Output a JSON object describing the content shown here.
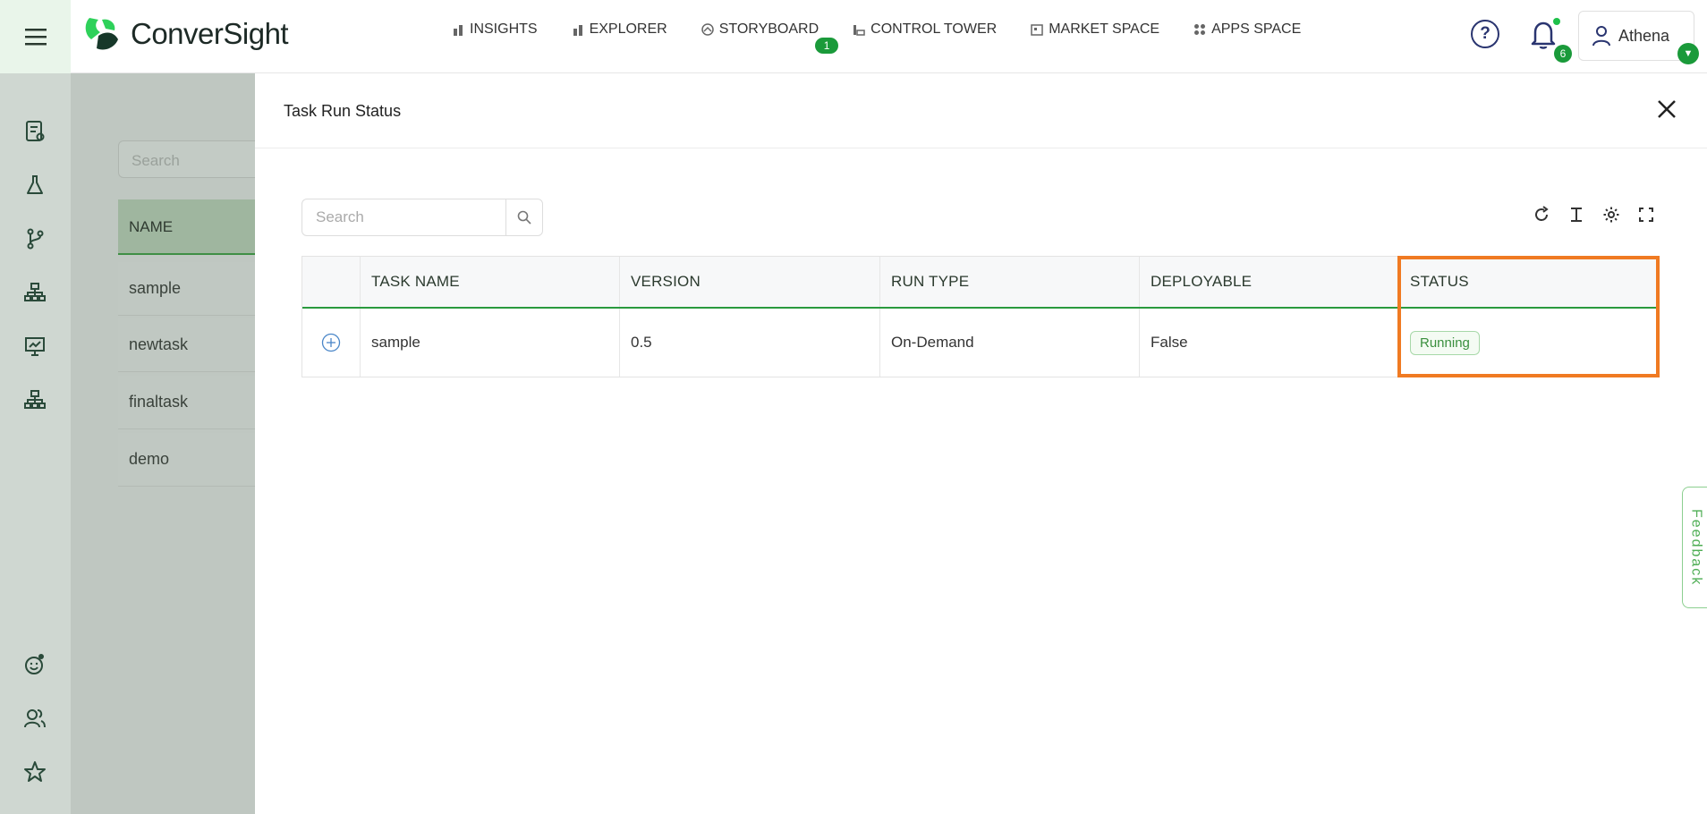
{
  "app": {
    "brand": "ConverSight",
    "colors": {
      "accent": "#1a9a3a",
      "highlight": "#f07a22",
      "sidebar": "#cfd7d1"
    }
  },
  "nav": {
    "items": [
      {
        "label": "INSIGHTS",
        "icon": "bar-chart-icon"
      },
      {
        "label": "EXPLORER",
        "icon": "bar-chart-icon"
      },
      {
        "label": "STORYBOARD",
        "icon": "storyboard-icon",
        "badge": "1"
      },
      {
        "label": "CONTROL TOWER",
        "icon": "control-tower-icon"
      },
      {
        "label": "MARKET SPACE",
        "icon": "market-icon"
      },
      {
        "label": "APPS SPACE",
        "icon": "apps-grid-icon"
      }
    ]
  },
  "header": {
    "help_icon": "?",
    "notifications_count": "6",
    "user_name": "Athena"
  },
  "background": {
    "search_placeholder": "Search",
    "table_header": "NAME",
    "rows": [
      "sample",
      "newtask",
      "finaltask",
      "demo"
    ]
  },
  "drawer": {
    "title": "Task Run Status",
    "search_placeholder": "Search",
    "columns": [
      "TASK NAME",
      "VERSION",
      "RUN TYPE",
      "DEPLOYABLE",
      "STATUS"
    ],
    "rows": [
      {
        "task_name": "sample",
        "version": "0.5",
        "run_type": "On-Demand",
        "deployable": "False",
        "status": "Running"
      }
    ]
  },
  "feedback_label": "Feedback"
}
